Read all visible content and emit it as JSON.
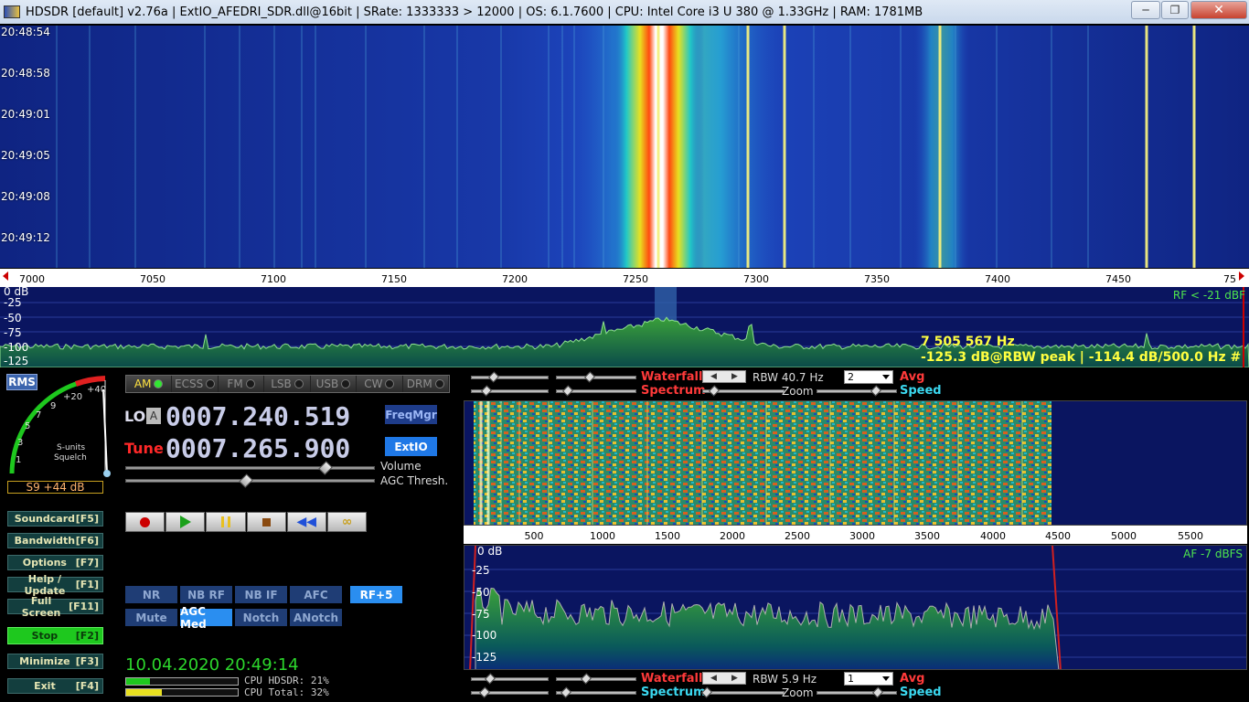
{
  "titlebar": {
    "title": "HDSDR  [default]  v2.76a  |  ExtIO_AFEDRI_SDR.dll@16bit  |  SRate: 1333333 > 12000  |  OS: 6.1.7600    |  CPU: Intel Core i3       U 380  @ 1.33GHz  |  RAM: 1781MB"
  },
  "waterfall": {
    "timestamps": [
      "20:48:54",
      "20:48:58",
      "20:49:01",
      "20:49:05",
      "20:49:08",
      "20:49:12"
    ]
  },
  "freq_scale": {
    "labels": [
      "7000",
      "7050",
      "7100",
      "7150",
      "7200",
      "7250",
      "7300",
      "7350",
      "7400",
      "7450",
      "75"
    ]
  },
  "spectrum": {
    "db_labels": [
      "0 dB",
      "-25",
      "-50",
      "-75",
      "-100",
      "-125"
    ],
    "rf_level": "RF < -21 dBF",
    "cursor_freq": "7 505 567 Hz",
    "cursor_peak": "-125.3 dB@RBW peak | -114.4 dB/500.0 Hz #"
  },
  "smeter": {
    "rms": "RMS",
    "scale": [
      "1",
      "3",
      "5",
      "7",
      "9",
      "+20",
      "+40"
    ],
    "caption1": "S-units",
    "caption2": "Squelch",
    "readout": "S9 +44 dB"
  },
  "side_buttons": [
    {
      "label": "Soundcard",
      "key": "[F5]"
    },
    {
      "label": "Bandwidth",
      "key": "[F6]"
    },
    {
      "label": "Options",
      "key": "[F7]"
    },
    {
      "label": "Help / Update",
      "key": "[F1]"
    },
    {
      "label": "Full Screen",
      "key": "[F11]"
    },
    {
      "label": "Stop",
      "key": "[F2]"
    },
    {
      "label": "Minimize",
      "key": "[F3]"
    },
    {
      "label": "Exit",
      "key": "[F4]"
    }
  ],
  "modes": [
    {
      "label": "AM",
      "active": true
    },
    {
      "label": "ECSS",
      "active": false
    },
    {
      "label": "FM",
      "active": false
    },
    {
      "label": "LSB",
      "active": false
    },
    {
      "label": "USB",
      "active": false
    },
    {
      "label": "CW",
      "active": false
    },
    {
      "label": "DRM",
      "active": false
    }
  ],
  "lo": {
    "label": "LO",
    "a": "A",
    "value": "0007.240.519"
  },
  "tune": {
    "label": "Tune",
    "value": "0007.265.900"
  },
  "buttons": {
    "freqmgr": "FreqMgr",
    "extio": "ExtIO"
  },
  "sliders": {
    "volume": "Volume",
    "agc": "AGC Thresh.",
    "volume_level": 0.8,
    "agc_level": 0.48
  },
  "dsp": {
    "row1": [
      "NR",
      "NB RF",
      "NB IF",
      "AFC"
    ],
    "rf_gain": "RF+5",
    "row2": [
      "Mute",
      "AGC Med",
      "Notch",
      "ANotch"
    ]
  },
  "status": {
    "datetime": "10.04.2020 20:49:14",
    "cpu_hdsdr": "CPU HDSDR: 21%",
    "cpu_total": "CPU Total: 32%"
  },
  "audio_controls": {
    "waterfall": "Waterfall",
    "spectrum": "Spectrum",
    "rbw_top": "RBW 40.7 Hz",
    "rbw_bottom": "RBW  5.9 Hz",
    "select_top": "2",
    "select_bottom": "1",
    "zoom": "Zoom",
    "avg": "Avg",
    "speed": "Speed"
  },
  "audio_scale": {
    "labels": [
      "500",
      "1000",
      "1500",
      "2000",
      "2500",
      "3000",
      "3500",
      "4000",
      "4500",
      "5000",
      "5500"
    ]
  },
  "audio_spectrum": {
    "db_labels": [
      "0 dB",
      "-25",
      "-50",
      "-75",
      "-100",
      "-125"
    ],
    "af_level": "AF  -7 dBFS"
  }
}
